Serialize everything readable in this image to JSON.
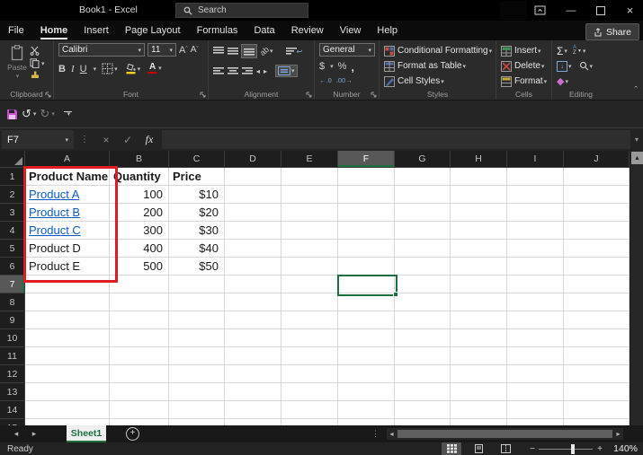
{
  "window": {
    "title": "Book1 - Excel",
    "search_placeholder": "Search"
  },
  "icons": {
    "dropdown": "▾",
    "minimize": "—",
    "close": "×",
    "undo": "↺",
    "redo": "↻",
    "cancel": "×",
    "enter": "✓",
    "ellipsis": "⋮",
    "sigma": "Σ",
    "sort_a": "A",
    "sort_z": "Z",
    "sort_arrow": "▼",
    "fill_down": "↓",
    "clear_diamond": "◆",
    "bold": "B",
    "italic": "I",
    "underline": "U",
    "grow_font": "A",
    "grow_caret": "ˆ",
    "shrink_font": "A",
    "shrink_caret": "ˇ",
    "dollar": "$",
    "percent": "%",
    "comma": ",",
    "increase_decimal": "←.0",
    "decrease_decimal": ".00→",
    "orientation": "ab",
    "wrap_arrow": "↩",
    "plus": "+",
    "scroll_up": "▲",
    "scroll_left": "◂",
    "scroll_right": "▸",
    "collapse_ribbon": "ˆ",
    "zoom_out": "−",
    "zoom_in": "+"
  },
  "tabs": {
    "items": [
      "File",
      "Home",
      "Insert",
      "Page Layout",
      "Formulas",
      "Data",
      "Review",
      "View",
      "Help"
    ],
    "active": "Home",
    "share_label": "Share"
  },
  "ribbon": {
    "groups": {
      "clipboard": "Clipboard",
      "font": "Font",
      "alignment": "Alignment",
      "number": "Number",
      "styles": "Styles",
      "cells": "Cells",
      "editing": "Editing"
    },
    "paste_label": "Paste",
    "font_name": "Calibri",
    "font_size": "11",
    "number_format": "General",
    "styles_items": [
      "Conditional Formatting",
      "Format as Table",
      "Cell Styles"
    ],
    "cells_items": [
      "Insert",
      "Delete",
      "Format"
    ]
  },
  "formula_bar": {
    "name_box": "F7",
    "fx": "fx",
    "value": ""
  },
  "grid": {
    "columns": [
      "A",
      "B",
      "C",
      "D",
      "E",
      "F",
      "G",
      "H",
      "I",
      "J"
    ],
    "visible_row_count": 15,
    "selected_cell": "F7",
    "selected_column": "F",
    "selected_row": "7",
    "red_annotation_range": "A1:A6",
    "rows": [
      {
        "n": "1",
        "cells": [
          {
            "col": "A",
            "value": "Product Name",
            "style": "bold"
          },
          {
            "col": "B",
            "value": "Quantity",
            "style": "bold"
          },
          {
            "col": "C",
            "value": "Price",
            "style": "bold"
          }
        ]
      },
      {
        "n": "2",
        "cells": [
          {
            "col": "A",
            "value": "Product A",
            "style": "link"
          },
          {
            "col": "B",
            "value": "100",
            "style": "num"
          },
          {
            "col": "C",
            "value": "$10",
            "style": "num"
          }
        ]
      },
      {
        "n": "3",
        "cells": [
          {
            "col": "A",
            "value": "Product B",
            "style": "link"
          },
          {
            "col": "B",
            "value": "200",
            "style": "num"
          },
          {
            "col": "C",
            "value": "$20",
            "style": "num"
          }
        ]
      },
      {
        "n": "4",
        "cells": [
          {
            "col": "A",
            "value": "Product C",
            "style": "link"
          },
          {
            "col": "B",
            "value": "300",
            "style": "num"
          },
          {
            "col": "C",
            "value": "$30",
            "style": "num"
          }
        ]
      },
      {
        "n": "5",
        "cells": [
          {
            "col": "A",
            "value": "Product D",
            "style": "plain"
          },
          {
            "col": "B",
            "value": "400",
            "style": "num"
          },
          {
            "col": "C",
            "value": "$40",
            "style": "num"
          }
        ]
      },
      {
        "n": "6",
        "cells": [
          {
            "col": "A",
            "value": "Product E",
            "style": "plain"
          },
          {
            "col": "B",
            "value": "500",
            "style": "num"
          },
          {
            "col": "C",
            "value": "$50",
            "style": "num"
          }
        ]
      }
    ]
  },
  "sheet_bar": {
    "active_tab": "Sheet1"
  },
  "status_bar": {
    "status": "Ready",
    "zoom_label": "140%"
  },
  "colors": {
    "accent_green": "#1d6f42",
    "hyperlink": "#0b5bc2",
    "annotation_red": "#e11b22",
    "save_icon_pink": "#c554cc",
    "fill_yellow": "#f2d21f",
    "font_color_red": "#c00000",
    "editing_blue": "#7da7d9",
    "clear_pink": "#cf6ccf"
  }
}
